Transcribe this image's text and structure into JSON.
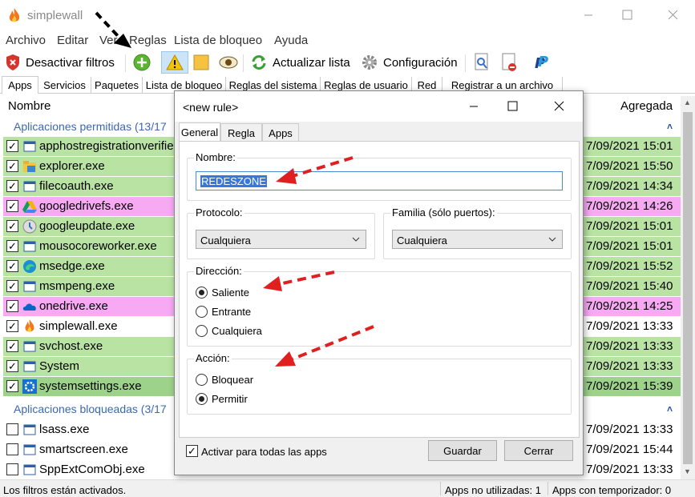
{
  "window": {
    "title": "simplewall"
  },
  "menu": [
    "Archivo",
    "Editar",
    "Ver",
    "Reglas",
    "Lista de bloqueo",
    "Ayuda"
  ],
  "toolbar": {
    "disable_filters": "Desactivar filtros",
    "refresh": "Actualizar lista",
    "settings": "Configuración"
  },
  "tabs": [
    "Apps",
    "Servicios",
    "Paquetes",
    "Lista de bloqueo",
    "Reglas del sistema",
    "Reglas de usuario",
    "Red",
    "Registrar a un archivo"
  ],
  "list": {
    "col_name": "Nombre",
    "col_added": "Agregada",
    "allowed_group": "Aplicaciones permitidas (13/17",
    "blocked_group": "Aplicaciones bloqueadas (3/17",
    "allowed_rows": [
      {
        "name": "apphostregistrationverifie",
        "date": "7/09/2021 15:01",
        "checked": "✓"
      },
      {
        "name": "explorer.exe",
        "date": "7/09/2021 15:50",
        "checked": "✓"
      },
      {
        "name": "filecoauth.exe",
        "date": "7/09/2021 14:34",
        "checked": "✓"
      },
      {
        "name": "googledrivefs.exe",
        "date": "7/09/2021 14:26",
        "checked": "✓"
      },
      {
        "name": "googleupdate.exe",
        "date": "7/09/2021 15:01",
        "checked": "✓"
      },
      {
        "name": "mousocoreworker.exe",
        "date": "7/09/2021 15:01",
        "checked": "✓"
      },
      {
        "name": "msedge.exe",
        "date": "7/09/2021 15:52",
        "checked": "✓"
      },
      {
        "name": "msmpeng.exe",
        "date": "7/09/2021 15:40",
        "checked": "✓"
      },
      {
        "name": "onedrive.exe",
        "date": "7/09/2021 14:25",
        "checked": "✓"
      },
      {
        "name": "simplewall.exe",
        "date": "7/09/2021 13:33",
        "checked": "✓"
      },
      {
        "name": "svchost.exe",
        "date": "7/09/2021 13:33",
        "checked": "✓"
      },
      {
        "name": "System",
        "date": "7/09/2021 13:33",
        "checked": "✓"
      },
      {
        "name": "systemsettings.exe",
        "date": "7/09/2021 15:39",
        "checked": "✓"
      }
    ],
    "blocked_rows": [
      {
        "name": "lsass.exe",
        "date": "7/09/2021 13:33",
        "checked": ""
      },
      {
        "name": "smartscreen.exe",
        "date": "7/09/2021 15:44",
        "checked": ""
      },
      {
        "name": "SppExtComObj.exe",
        "date": "7/09/2021 13:33",
        "checked": ""
      }
    ]
  },
  "status": {
    "filters": "Los filtros están activados.",
    "unused": "Apps no utilizadas: 1",
    "timer": "Apps con temporizador: 0"
  },
  "dialog": {
    "title": "<new rule>",
    "tabs": [
      "General",
      "Regla",
      "Apps"
    ],
    "name_label": "Nombre:",
    "name_value": "REDESZONE",
    "protocol_label": "Protocolo:",
    "protocol_value": "Cualquiera",
    "family_label": "Familia (sólo puertos):",
    "family_value": "Cualquiera",
    "direction_label": "Dirección:",
    "direction_options": [
      "Saliente",
      "Entrante",
      "Cualquiera"
    ],
    "direction_selected": "Saliente",
    "action_label": "Acción:",
    "action_options": [
      "Bloquear",
      "Permitir"
    ],
    "action_selected": "Permitir",
    "apply_all": "Activar para todas las apps",
    "save": "Guardar",
    "close": "Cerrar"
  },
  "colors": {
    "allowed_row": "#b9e3a2",
    "special_row": "#f7a9f3",
    "annotation_arrow": "#e02020"
  }
}
